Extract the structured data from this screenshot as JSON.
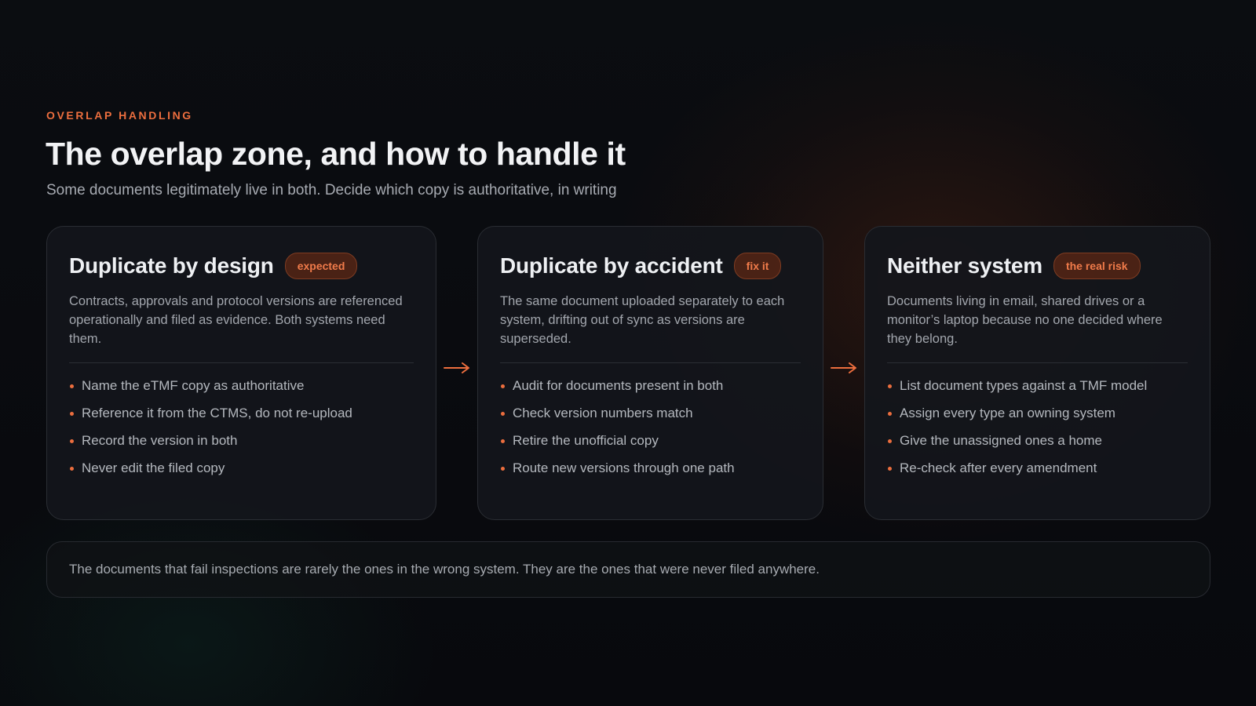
{
  "header": {
    "eyebrow": "OVERLAP HANDLING",
    "title": "The overlap zone, and how to handle it",
    "subtitle": "Some documents legitimately live in both. Decide which copy is authoritative, in writing"
  },
  "cards": [
    {
      "title": "Duplicate by design",
      "badge": "expected",
      "description": "Contracts, approvals and protocol versions are referenced operationally and filed as evidence. Both systems need them.",
      "bullets": [
        "Name the eTMF copy as authoritative",
        "Reference it from the CTMS, do not re-upload",
        "Record the version in both",
        "Never edit the filed copy"
      ]
    },
    {
      "title": "Duplicate by accident",
      "badge": "fix it",
      "description": "The same document uploaded separately to each system, drifting out of sync as versions are superseded.",
      "bullets": [
        "Audit for documents present in both",
        "Check version numbers match",
        "Retire the unofficial copy",
        "Route new versions through one path"
      ]
    },
    {
      "title": "Neither system",
      "badge": "the real risk",
      "description": "Documents living in email, shared drives or a monitor’s laptop because no one decided where they belong.",
      "bullets": [
        "List document types against a TMF model",
        "Assign every type an owning system",
        "Give the unassigned ones a home",
        "Re-check after every amendment"
      ]
    }
  ],
  "footer_note": "The documents that fail inspections are rarely the ones in the wrong system. They are the ones that were never filed anywhere.",
  "icons": {
    "arrow": "arrow-right-icon"
  },
  "colors": {
    "accent": "#ec6e3e",
    "background": "#080a0e",
    "card": "#13161b",
    "text": "#eef0f3",
    "muted": "#a2a6ad"
  }
}
